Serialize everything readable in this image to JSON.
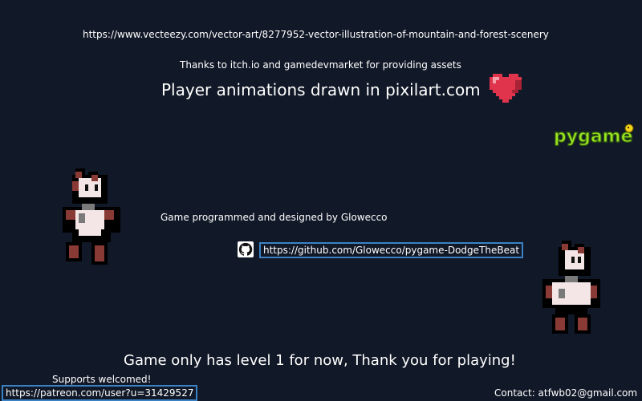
{
  "credits": {
    "background_url": "https://www.vecteezy.com/vector-art/8277952-vector-illustration-of-mountain-and-forest-scenery",
    "assets_thanks": "Thanks to itch.io and gamedevmarket for providing assets",
    "player_animations": "Player animations drawn in pixilart.com",
    "programmer": "Game programmed and designed by Glowecco",
    "github_url": "https://github.com/Glowecco/pygame-DodgeTheBeat",
    "closing_message": "Game only has level 1 for now, Thank you for playing!",
    "supports_label": "Supports welcomed!",
    "patreon_url": "https://patreon.com/user?u=31429527",
    "contact": "Contact: atfwb02@gmail.com"
  },
  "logos": {
    "pygame": "pygame"
  },
  "icons": [
    "heart-icon",
    "github-icon",
    "pygame-logo",
    "player-sprite"
  ],
  "colors": {
    "background": "#111827",
    "text": "#ffffff",
    "link_border": "#3b82c4",
    "heart": "#e0344c",
    "sprite_outline": "#000000",
    "sprite_body": "#f4e6e6",
    "sprite_accent": "#8a3a34"
  }
}
